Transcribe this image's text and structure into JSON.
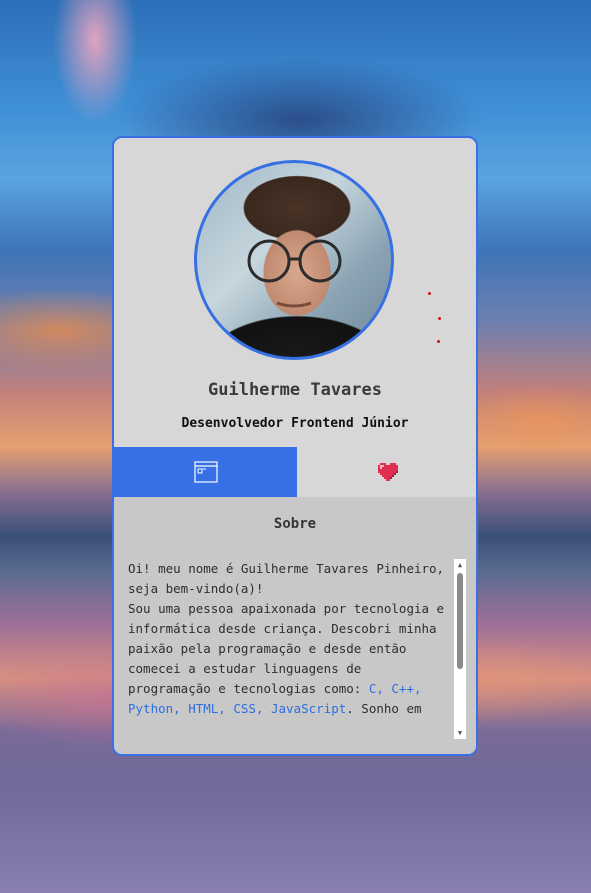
{
  "profile": {
    "name": "Guilherme Tavares",
    "role": "Desenvolvedor Frontend Júnior",
    "avatar_alt": "Profile photo"
  },
  "tabs": [
    {
      "name": "about",
      "icon": "browser-window-icon",
      "active": true
    },
    {
      "name": "likes",
      "icon": "heart-icon",
      "active": false
    }
  ],
  "about": {
    "title": "Sobre",
    "text_parts": [
      "Oi! meu nome é Guilherme Tavares Pinheiro, seja bem-vindo(a)!\nSou uma pessoa apaixonada por tecnologia e informática desde criança. Descobri minha paixão pela programação e desde então comecei a estudar linguagens de programação e tecnologias como: ",
      "C, C++, Python, HTML, CSS, JavaScript",
      ". Sonho em"
    ]
  },
  "colors": {
    "accent": "#3570e4",
    "heart": "#e0304f",
    "tech_text": "#2f6ee0",
    "dots": "#d01818"
  }
}
